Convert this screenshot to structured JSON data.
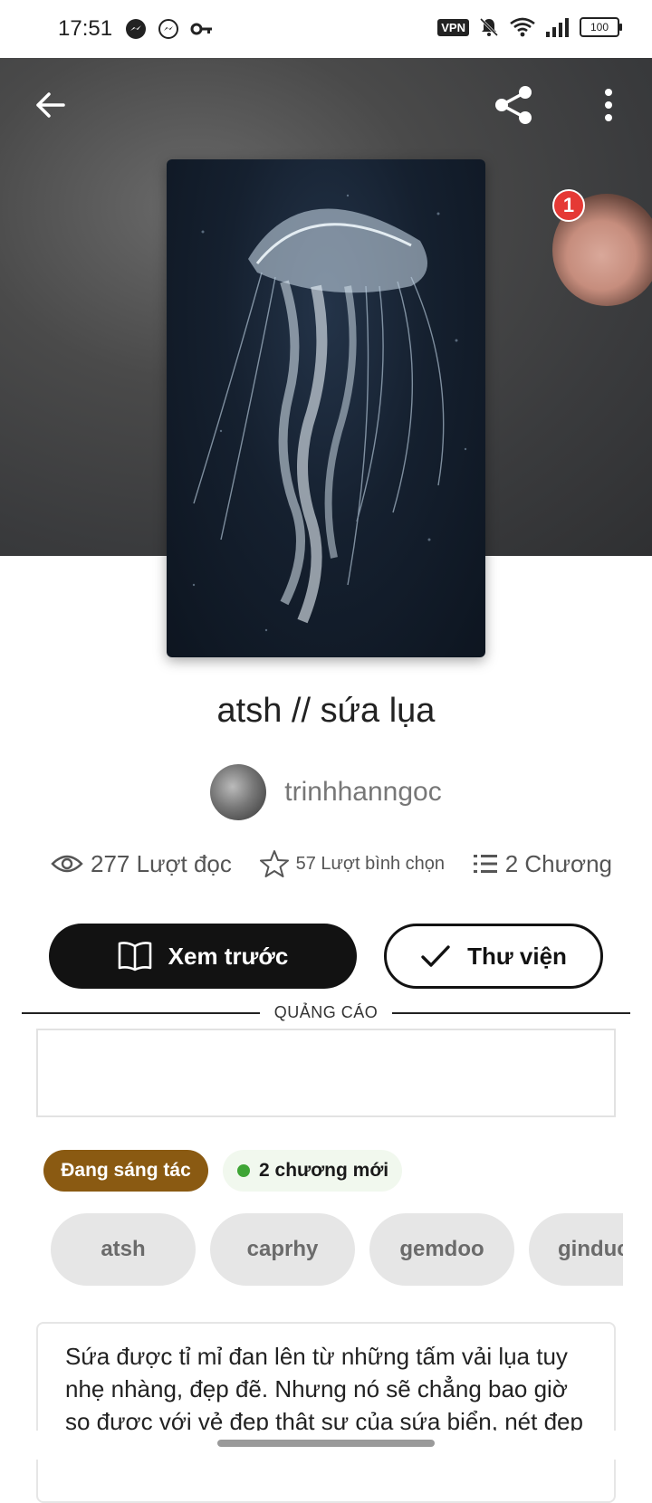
{
  "status_bar": {
    "time": "17:51",
    "vpn": "VPN",
    "battery": "100",
    "left_icons": [
      "messenger-icon",
      "messenger-outline-icon",
      "key-icon"
    ],
    "right_icons": [
      "vpn-icon",
      "bell-off-icon",
      "wifi-icon",
      "signal-icon",
      "battery-icon"
    ]
  },
  "header": {
    "icons": [
      "back-arrow-icon",
      "share-icon",
      "more-vertical-icon"
    ]
  },
  "floating_bubble": {
    "badge": "1"
  },
  "story": {
    "title": "atsh // sứa lụa",
    "author": "trinhhanngoc"
  },
  "stats": {
    "reads": "277 Lượt đọc",
    "votes": "57 Lượt bình chọn",
    "chapters": "2 Chương"
  },
  "actions": {
    "preview": "Xem trước",
    "library": "Thư viện"
  },
  "ad": {
    "label": "QUẢNG CÁO"
  },
  "status_tags": {
    "writing": "Đang sáng tác",
    "new_chapters": "2 chương mới"
  },
  "tags": [
    "atsh",
    "caprhy",
    "gemdoo",
    "ginduc"
  ],
  "description": {
    "line1": "Sứa được tỉ mỉ đan lên từ những tấm vải lụa tuy",
    "line2": "nhẹ nhàng, đẹp đẽ. Nhưng nó sẽ chẳng bao giờ",
    "line3": "so được với vẻ đẹp thật sự của sứa biển, nét đẹp"
  },
  "colors": {
    "primary_button": "#121212",
    "writing_tag": "#8a5a12",
    "new_dot": "#3fa535",
    "badge": "#e53935"
  }
}
